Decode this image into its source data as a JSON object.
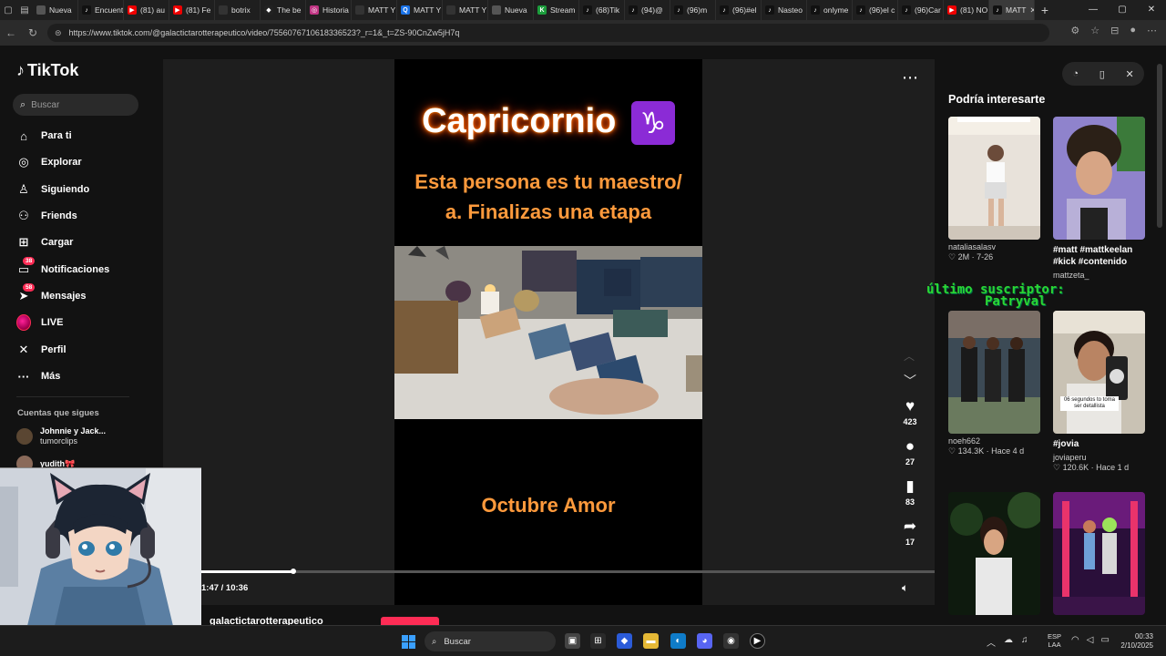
{
  "browser": {
    "tabs": [
      {
        "label": "Nueva",
        "color": "#555"
      },
      {
        "label": "Encuentra",
        "color": "#111",
        "glyph": "♪"
      },
      {
        "label": "(81) au",
        "color": "#e00",
        "glyph": "▶"
      },
      {
        "label": "(81) Fe",
        "color": "#e00",
        "glyph": "▶"
      },
      {
        "label": "botrix",
        "color": "#333"
      },
      {
        "label": "The be",
        "color": "#222",
        "glyph": "◆"
      },
      {
        "label": "Historia",
        "color": "#c13584",
        "glyph": "◎"
      },
      {
        "label": "MATT Y",
        "color": "#333"
      },
      {
        "label": "MATT Y",
        "color": "#1a73e8",
        "glyph": "Q"
      },
      {
        "label": "MATT Y",
        "color": "#333"
      },
      {
        "label": "Nueva",
        "color": "#555"
      },
      {
        "label": "Stream",
        "color": "#1c9d3c",
        "glyph": "K"
      },
      {
        "label": "(68)Tik",
        "color": "#111",
        "glyph": "♪"
      },
      {
        "label": "(94)@",
        "color": "#111",
        "glyph": "♪"
      },
      {
        "label": "(96)m",
        "color": "#111",
        "glyph": "♪"
      },
      {
        "label": "(96)#el",
        "color": "#111",
        "glyph": "♪"
      },
      {
        "label": "Nasteo",
        "color": "#111",
        "glyph": "♪"
      },
      {
        "label": "onlyme",
        "color": "#111",
        "glyph": "♪"
      },
      {
        "label": "(96)el c",
        "color": "#111",
        "glyph": "♪"
      },
      {
        "label": "(96)Car",
        "color": "#111",
        "glyph": "♪"
      },
      {
        "label": "(81) NO",
        "color": "#e00",
        "glyph": "▶"
      },
      {
        "label": "MATT",
        "color": "#111",
        "glyph": "♪",
        "active": true
      }
    ],
    "url": "https://www.tiktok.com/@galactictarotterapeutico/video/7556076710618336523?_r=1&_t=ZS-90CnZw5jH7q"
  },
  "sidebar": {
    "brand": "TikTok",
    "search_placeholder": "Buscar",
    "nav": [
      {
        "label": "Para ti",
        "icon": "home-icon",
        "glyph": "⌂"
      },
      {
        "label": "Explorar",
        "icon": "compass-icon",
        "glyph": "◎"
      },
      {
        "label": "Siguiendo",
        "icon": "following-icon",
        "glyph": "♙"
      },
      {
        "label": "Friends",
        "icon": "friends-icon",
        "glyph": "⚇"
      },
      {
        "label": "Cargar",
        "icon": "upload-icon",
        "glyph": "⊞"
      },
      {
        "label": "Notificaciones",
        "icon": "inbox-icon",
        "glyph": "▭",
        "badge": "38"
      },
      {
        "label": "Mensajes",
        "icon": "messages-icon",
        "glyph": "➤",
        "badge": "58"
      },
      {
        "label": "LIVE",
        "icon": "live-avatar-icon",
        "glyph": ""
      },
      {
        "label": "Perfil",
        "icon": "profile-icon",
        "glyph": "✕"
      },
      {
        "label": "Más",
        "icon": "more-icon",
        "glyph": "···"
      }
    ],
    "following_title": "Cuentas que sigues",
    "following": [
      {
        "name": "Johnnie y Jack...",
        "handle": "tumorclips"
      },
      {
        "name": "yudith🎀",
        "handle": ""
      }
    ]
  },
  "video": {
    "title": "Capricornio",
    "zodiac_glyph": "♑",
    "subtitle_line1": "Esta persona es tu maestro/",
    "subtitle_line2": "a. Finalizas una etapa",
    "bottom_text": "Octubre Amor",
    "time": "1:47 / 10:36",
    "progress": 0.126,
    "author": "galactictarotterapeutico",
    "likes": "423",
    "comments": "27",
    "saves": "83",
    "shares": "17"
  },
  "recommended": {
    "title": "Podría interesarte",
    "overlay_line1": "último suscriptor:",
    "overlay_line2": "Patryval",
    "cards": [
      {
        "caption": "",
        "user": "nataliasalasv",
        "meta": "♡ 2M · 7-26"
      },
      {
        "caption": "#matt #mattkeelan #kick #contenido",
        "user": "mattzeta_",
        "meta": ""
      },
      {
        "caption": "",
        "user": "noeh662",
        "meta": "♡ 134.3K · Hace 4 d"
      },
      {
        "caption": "#jovia",
        "user": "joviaperu",
        "meta": "♡ 120.6K · Hace 1 d"
      }
    ],
    "phone_overlay_text": "06 segundos to toma ser detallista"
  },
  "taskbar": {
    "search": "Buscar",
    "lang_line1": "ESP",
    "lang_line2": "LAA",
    "time": "00:33",
    "date": "2/10/2025"
  }
}
